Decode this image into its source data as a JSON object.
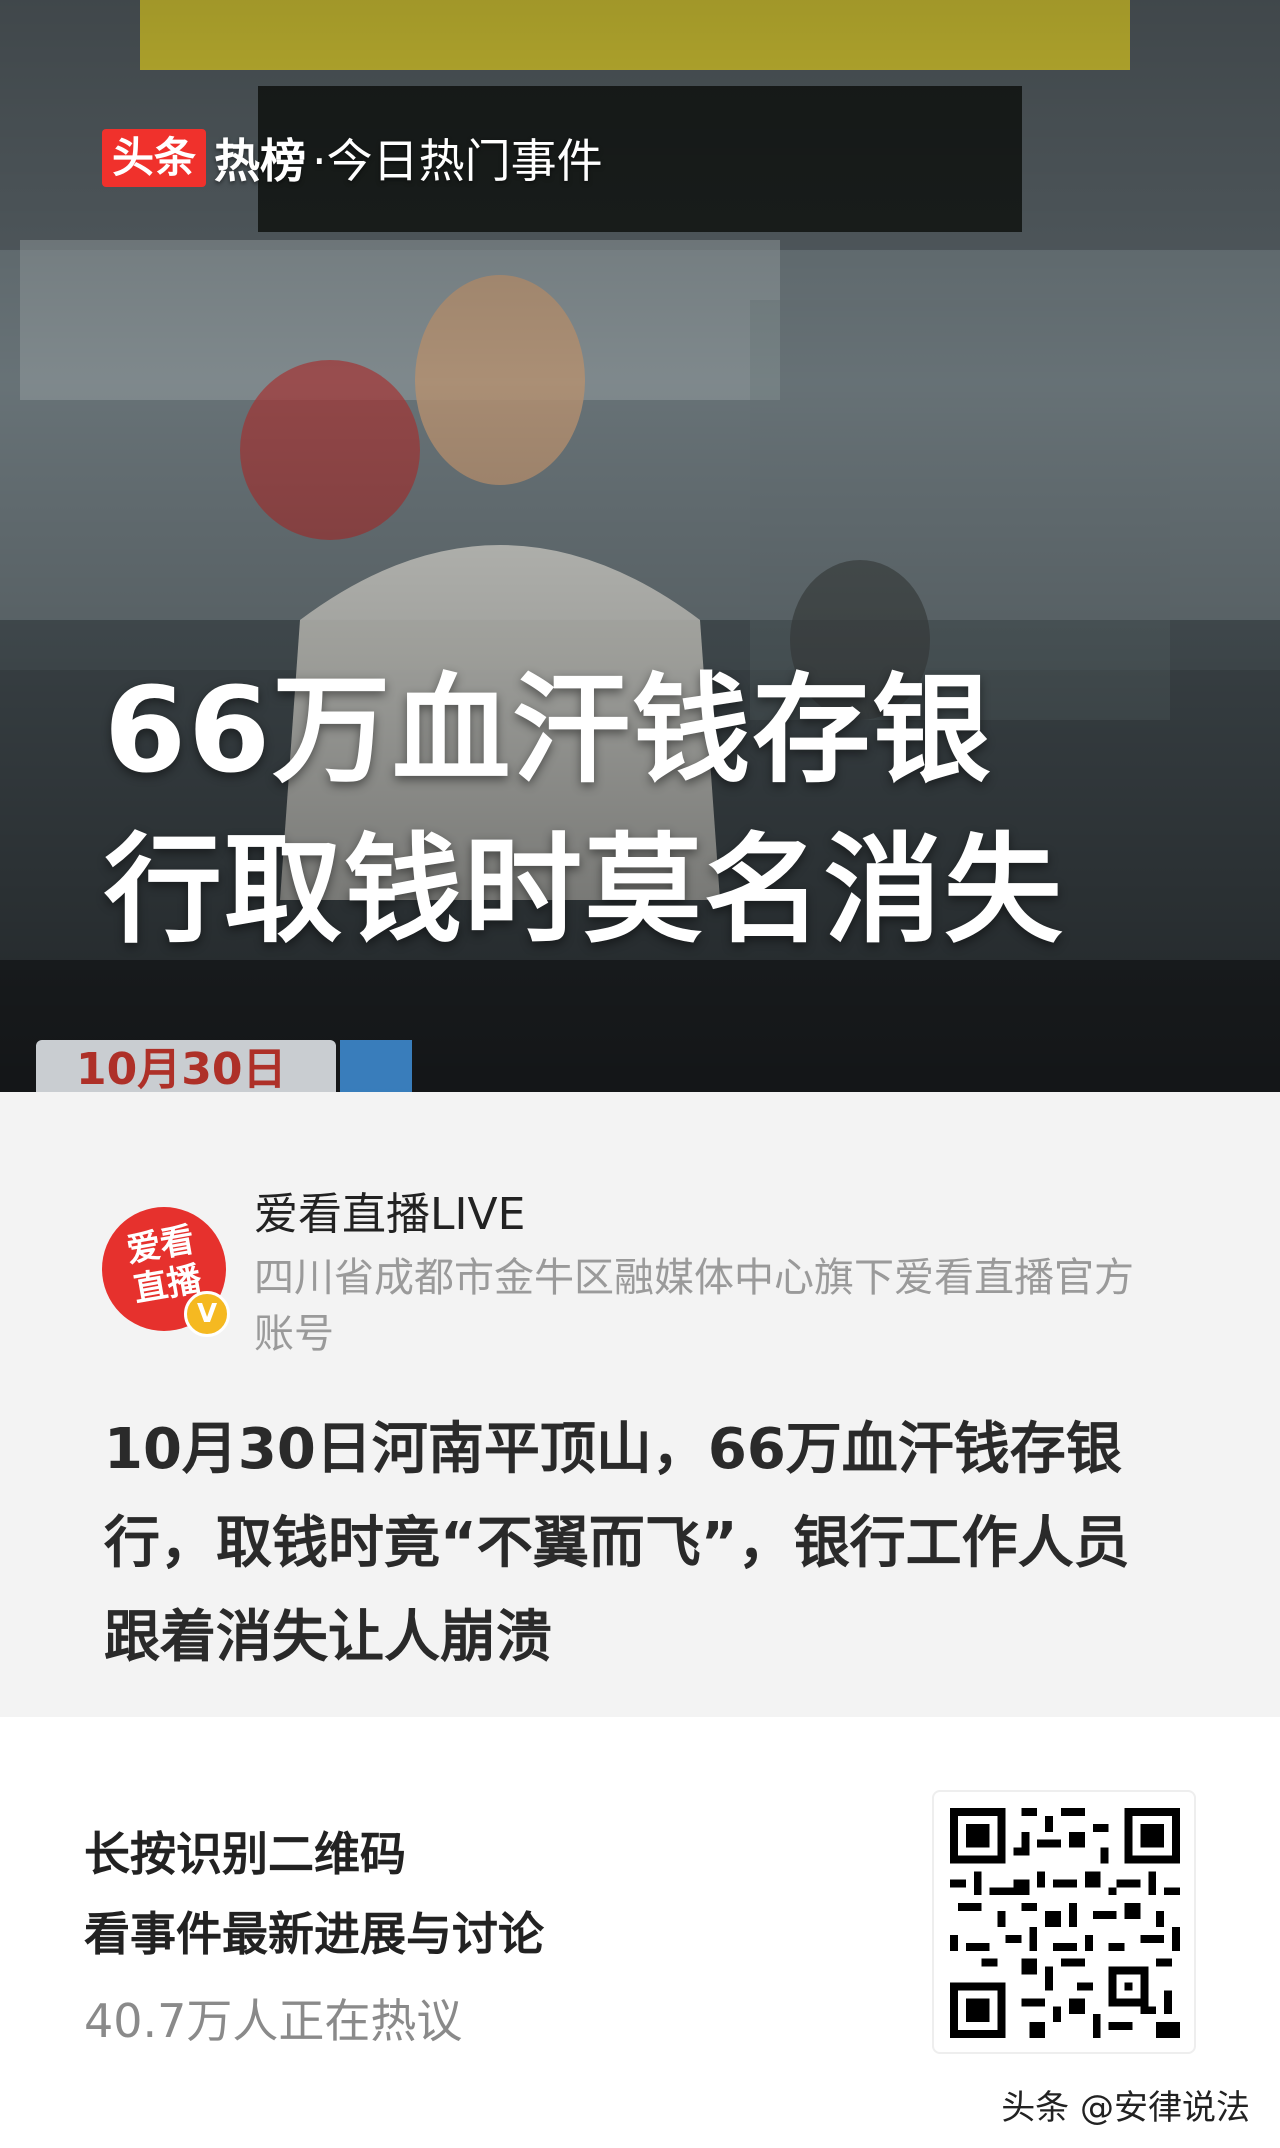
{
  "hero": {
    "brand_badge": "头条",
    "brand_hot": "热榜",
    "brand_sub": "·今日热门事件",
    "headline_line1": "66万血汗钱存银",
    "headline_line2": "行取钱时莫名消失",
    "date_tag": "10月30日"
  },
  "author": {
    "avatar_text": "爱看直播",
    "verified": "V",
    "name": "爱看直播LIVE",
    "description": "四川省成都市金牛区融媒体中心旗下爱看直播官方账号"
  },
  "news": {
    "body": "10月30日河南平顶山，66万血汗钱存银行，取钱时竟“不翼而飞”，银行工作人员跟着消失让人崩溃"
  },
  "footer": {
    "cta_line1": "长按识别二维码",
    "cta_line2": "看事件最新进展与讨论",
    "heat_count": "40.7万人正在热议",
    "watermark": "头条 @安律说法"
  },
  "colors": {
    "brand_red": "#f0312c",
    "avatar_red": "#e6312d",
    "verified_yellow": "#f5b921",
    "card_bg": "#f3f3f3"
  },
  "icons": [
    "verified-badge-icon",
    "qr-code"
  ]
}
